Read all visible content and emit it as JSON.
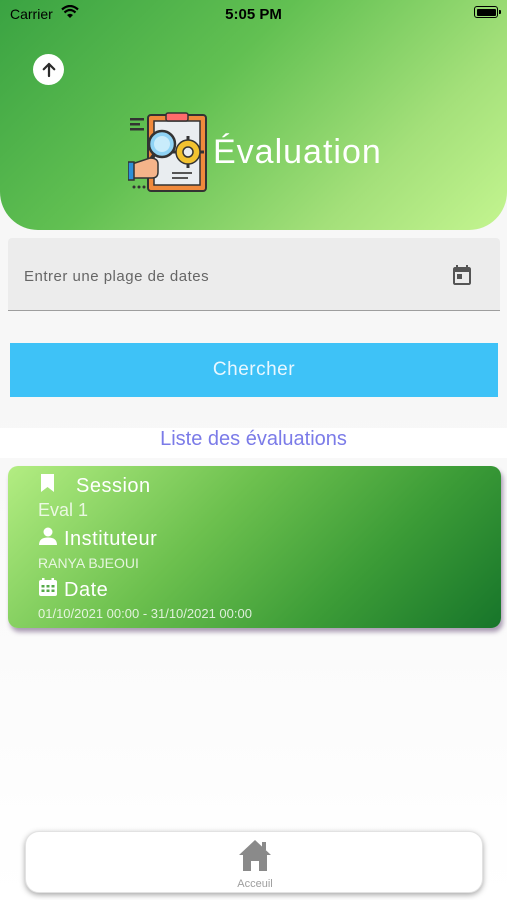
{
  "status_bar": {
    "carrier": "Carrier",
    "time": "5:05 PM"
  },
  "header": {
    "title": "Évaluation",
    "icon": "evaluation-clipboard-icon"
  },
  "date_field": {
    "placeholder": "Entrer une plage de dates",
    "icon": "calendar-icon"
  },
  "search_button": {
    "label": "Chercher"
  },
  "list": {
    "title": "Liste des évaluations",
    "items": [
      {
        "session_label": "Session",
        "session_value": "Eval 1",
        "instituteur_label": "Instituteur",
        "instituteur_value": "RANYA BJEOUI",
        "date_label": "Date",
        "date_value": "01/10/2021 00:00 - 31/10/2021 00:00"
      }
    ]
  },
  "bottom_nav": {
    "items": [
      {
        "label": "Acceuil",
        "icon": "home-icon"
      }
    ]
  },
  "colors": {
    "header_start": "#3aa342",
    "header_end": "#c4f590",
    "search_button": "#3ec2f7",
    "list_title": "#7b7be8",
    "card_start": "#b3ed82",
    "card_end": "#17752a"
  }
}
